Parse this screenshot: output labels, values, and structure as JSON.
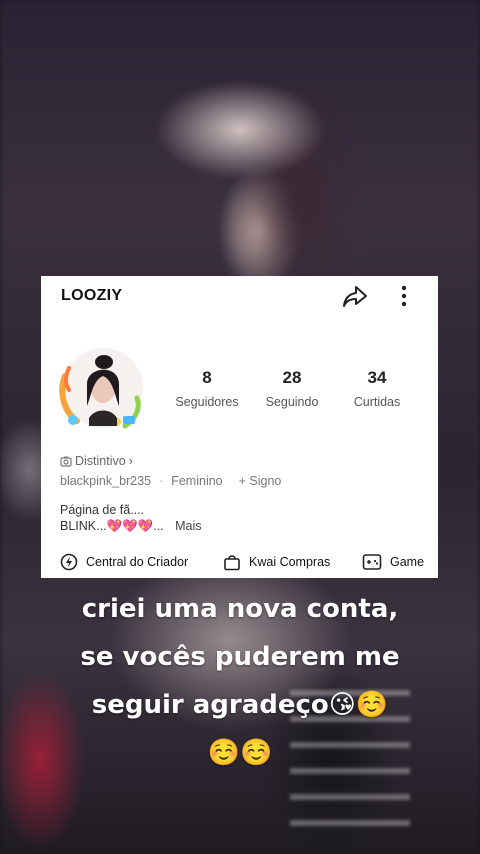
{
  "profile": {
    "username": "LOOZIY",
    "stats": [
      {
        "value": "8",
        "label": "Seguidores"
      },
      {
        "value": "28",
        "label": "Seguindo"
      },
      {
        "value": "34",
        "label": "Curtidas"
      }
    ],
    "badge": "Distintivo",
    "badge_chevron": "›",
    "handle": "blackpink_br235",
    "separator": "·",
    "gender": "Feminino",
    "sign": "+ Signo",
    "bio_line1": "Página de fã....",
    "bio_line2": "BLINK...💖💖💖...",
    "bio_more": "Mais"
  },
  "footer": {
    "creator": "Central do Criador",
    "shop": "Kwai Compras",
    "game": "Game"
  },
  "caption": {
    "line1": "criei uma nova conta,",
    "line2": "se vocês puderem me",
    "line3": "seguir agradeço😘☺️",
    "line4": "☺️☺️"
  },
  "icons": {
    "share": "share-arrow",
    "more": "vertical-dots",
    "creator": "lightning-circle",
    "shop": "shopping-bag",
    "game": "gamepad",
    "badge": "camera-badge"
  }
}
